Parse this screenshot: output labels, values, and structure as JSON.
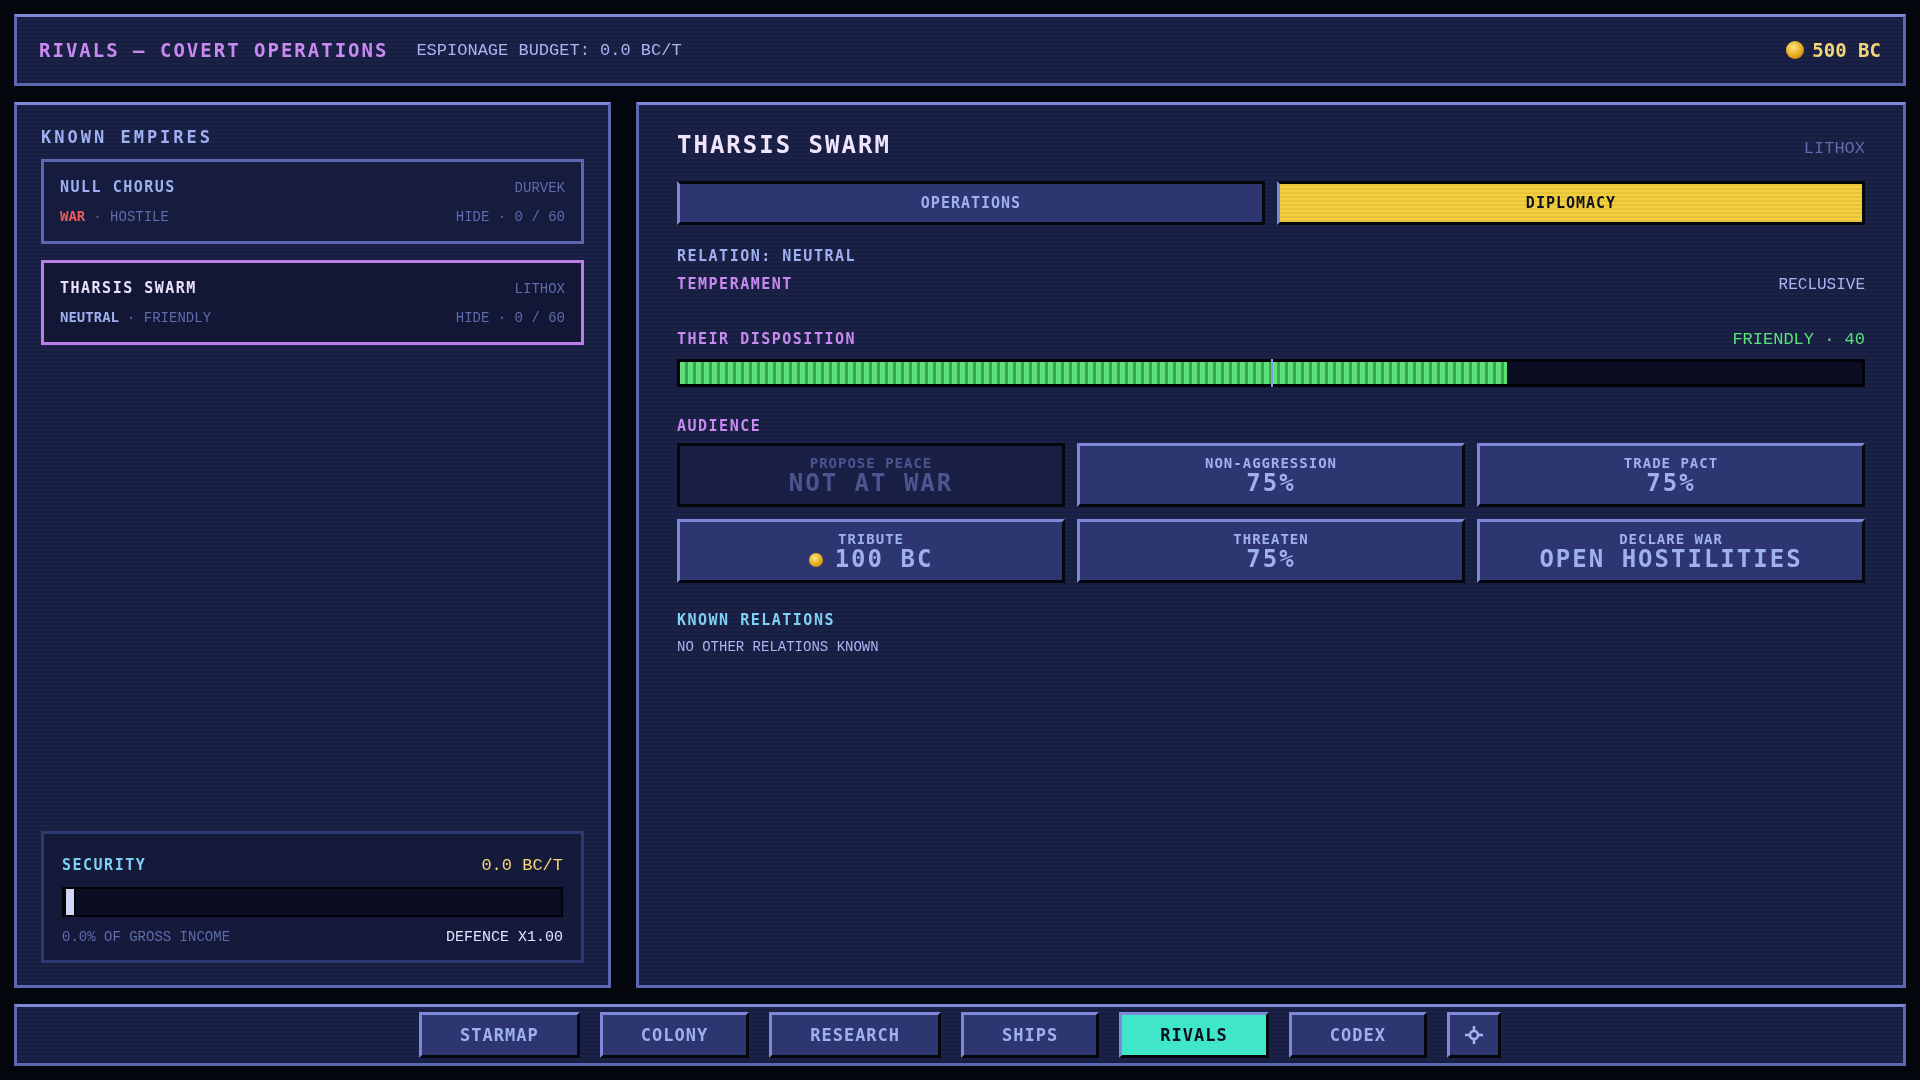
{
  "header": {
    "title": "RIVALS — COVERT OPERATIONS",
    "budget": "ESPIONAGE BUDGET: 0.0 BC/T",
    "credits": "500 BC"
  },
  "sidebar": {
    "title": "KNOWN EMPIRES",
    "empires": [
      {
        "name": "NULL CHORUS",
        "species": "DURVEK",
        "stance": {
          "text": "WAR",
          "kind": "war"
        },
        "attitude": "· HOSTILE",
        "hide": "HIDE · 0 / 60",
        "selected": false
      },
      {
        "name": "THARSIS SWARM",
        "species": "LITHOX",
        "stance": {
          "text": "NEUTRAL",
          "kind": "neutral"
        },
        "attitude": "· FRIENDLY",
        "hide": "HIDE · 0 / 60",
        "selected": true
      }
    ],
    "security": {
      "label": "SECURITY",
      "rate": "0.0 BC/T",
      "level": 0,
      "share": "0.0% OF GROSS INCOME",
      "defence": "DEFENCE X1.00"
    }
  },
  "detail": {
    "name": "THARSIS SWARM",
    "species": "LITHOX",
    "tabs": [
      {
        "label": "OPERATIONS",
        "selected": false
      },
      {
        "label": "DIPLOMACY",
        "selected": true
      }
    ],
    "relation": "RELATION: NEUTRAL",
    "temperament_label": "TEMPERAMENT",
    "temperament": "RECLUSIVE",
    "disposition": {
      "label": "THEIR DISPOSITION",
      "reading": "FRIENDLY · 40",
      "level": 0.7
    },
    "audience": {
      "title": "AUDIENCE",
      "actions": [
        {
          "label": "PROPOSE PEACE",
          "value": "NOT AT WAR",
          "disabled": true,
          "kind": "plain"
        },
        {
          "label": "NON-AGGRESSION",
          "value": "75%",
          "disabled": false,
          "kind": "plain"
        },
        {
          "label": "TRADE PACT",
          "value": "75%",
          "disabled": false,
          "kind": "plain"
        },
        {
          "label": "TRIBUTE",
          "value": "100 BC",
          "disabled": false,
          "kind": "coin"
        },
        {
          "label": "THREATEN",
          "value": "75%",
          "disabled": false,
          "kind": "plain"
        },
        {
          "label": "DECLARE WAR",
          "value": "OPEN HOSTILITIES",
          "disabled": false,
          "kind": "plain"
        }
      ]
    },
    "relations": {
      "title": "KNOWN RELATIONS",
      "text": "NO OTHER RELATIONS KNOWN"
    }
  },
  "nav": [
    {
      "label": "STARMAP",
      "selected": false
    },
    {
      "label": "COLONY",
      "selected": false
    },
    {
      "label": "RESEARCH",
      "selected": false
    },
    {
      "label": "SHIPS",
      "selected": false
    },
    {
      "label": "RIVALS",
      "selected": true
    },
    {
      "label": "CODEX",
      "selected": false
    }
  ]
}
